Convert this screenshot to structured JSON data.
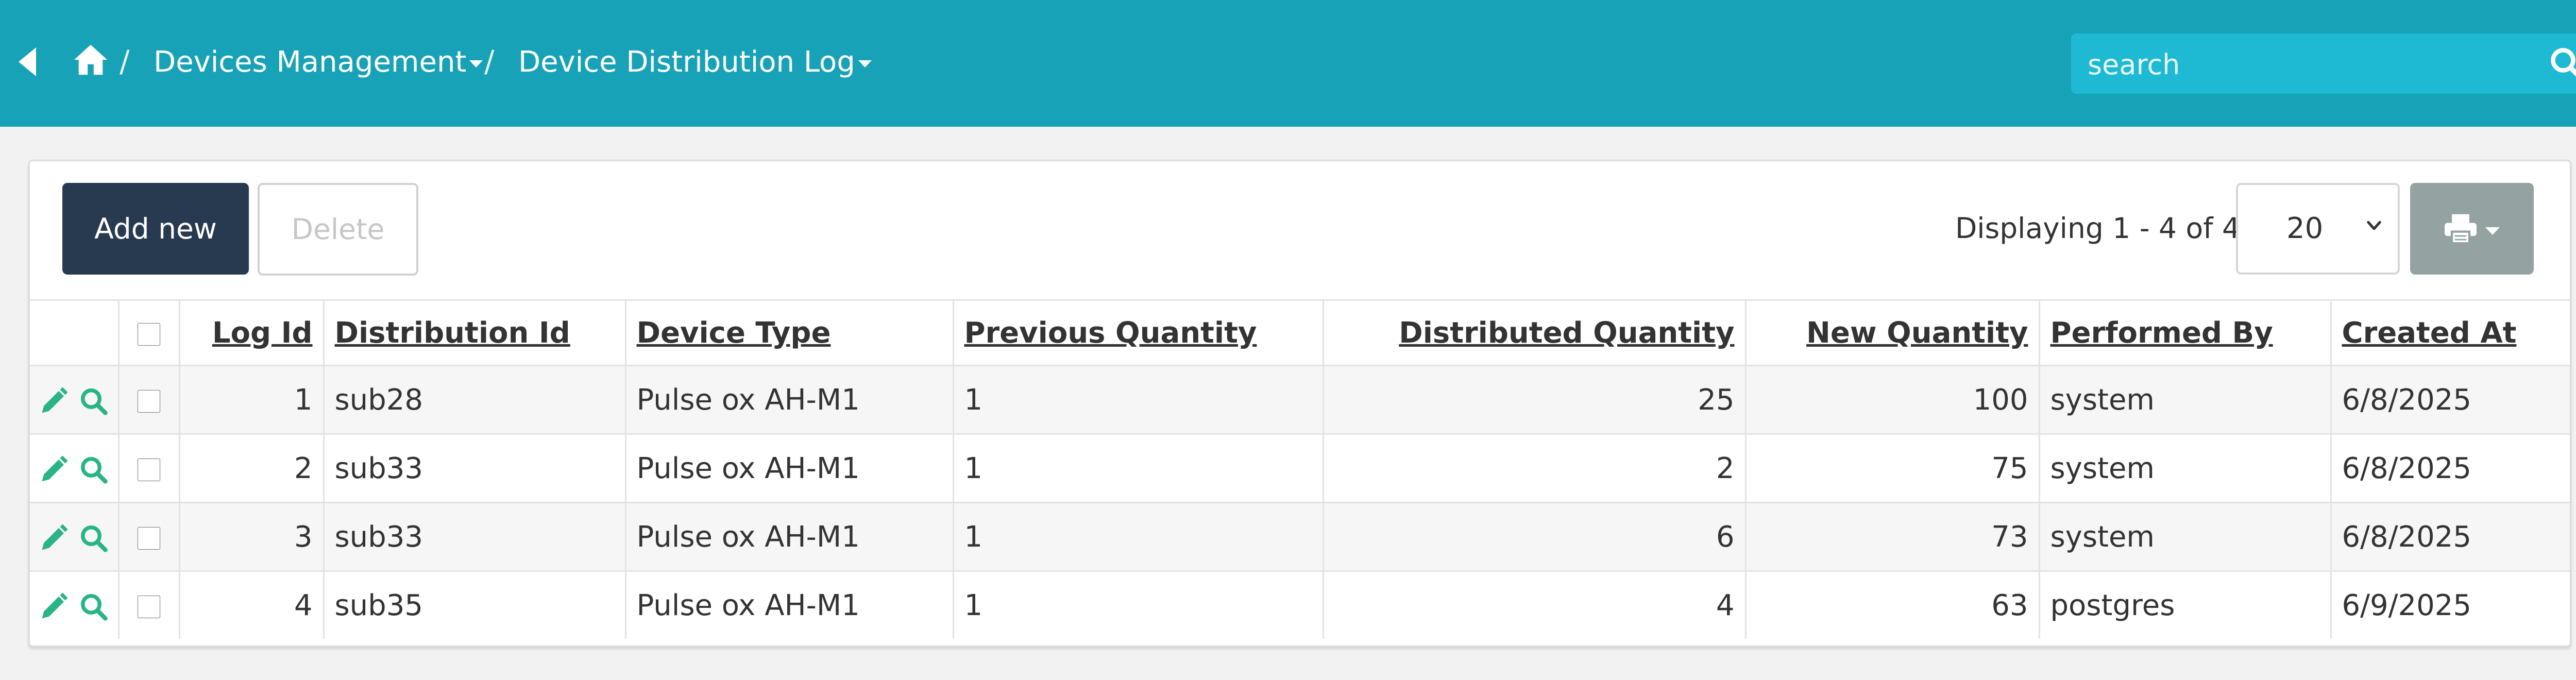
{
  "header": {
    "breadcrumbs": [
      {
        "label": "Devices Management"
      },
      {
        "label": "Device Distribution Log"
      }
    ],
    "separator": "/",
    "search_placeholder": "search",
    "search_value": ""
  },
  "toolbar": {
    "add_label": "Add new",
    "delete_label": "Delete",
    "displaying_text": "Displaying 1 - 4 of 4",
    "page_size": "20"
  },
  "table": {
    "columns": [
      "Log Id",
      "Distribution Id",
      "Device Type",
      "Previous Quantity",
      "Distributed Quantity",
      "New Quantity",
      "Performed By",
      "Created At"
    ],
    "rows": [
      {
        "log_id": "1",
        "distribution_id": "sub28",
        "device_type": "Pulse ox AH-M1",
        "previous_quantity": "1",
        "distributed_quantity": "25",
        "new_quantity": "100",
        "performed_by": "system",
        "created_at": "6/8/2025"
      },
      {
        "log_id": "2",
        "distribution_id": "sub33",
        "device_type": "Pulse ox AH-M1",
        "previous_quantity": "1",
        "distributed_quantity": "2",
        "new_quantity": "75",
        "performed_by": "system",
        "created_at": "6/8/2025"
      },
      {
        "log_id": "3",
        "distribution_id": "sub33",
        "device_type": "Pulse ox AH-M1",
        "previous_quantity": "1",
        "distributed_quantity": "6",
        "new_quantity": "73",
        "performed_by": "system",
        "created_at": "6/8/2025"
      },
      {
        "log_id": "4",
        "distribution_id": "sub35",
        "device_type": "Pulse ox AH-M1",
        "previous_quantity": "1",
        "distributed_quantity": "4",
        "new_quantity": "63",
        "performed_by": "postgres",
        "created_at": "6/9/2025"
      }
    ]
  },
  "icons": {
    "back": "back-arrow-icon",
    "home": "home-icon",
    "search": "search-icon",
    "edit": "pencil-icon",
    "view": "magnifier-icon",
    "print": "printer-icon"
  },
  "colors": {
    "header_bg": "#17a2b8",
    "search_bg": "#1ebad3",
    "add_button_bg": "#283a4f",
    "print_button_bg": "#95a2a2",
    "action_icon": "#28b487"
  }
}
